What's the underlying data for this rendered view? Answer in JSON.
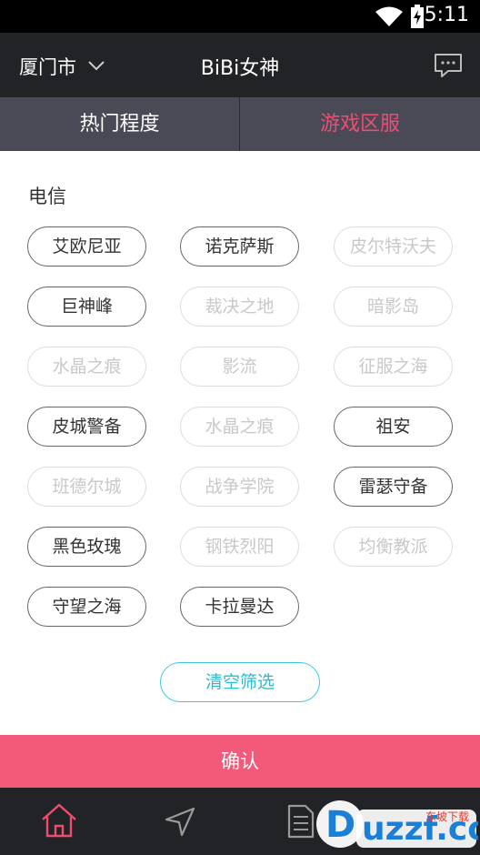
{
  "status_bar": {
    "time": "5:11"
  },
  "header": {
    "city": "厦门市",
    "title": "BiBi女神"
  },
  "tabs": [
    {
      "label": "热门程度",
      "active": false
    },
    {
      "label": "游戏区服",
      "active": true
    }
  ],
  "section": {
    "title": "电信"
  },
  "servers": [
    {
      "label": "艾欧尼亚",
      "enabled": true
    },
    {
      "label": "诺克萨斯",
      "enabled": true
    },
    {
      "label": "皮尔特沃夫",
      "enabled": false
    },
    {
      "label": "巨神峰",
      "enabled": true
    },
    {
      "label": "裁决之地",
      "enabled": false
    },
    {
      "label": "暗影岛",
      "enabled": false
    },
    {
      "label": "水晶之痕",
      "enabled": false
    },
    {
      "label": "影流",
      "enabled": false
    },
    {
      "label": "征服之海",
      "enabled": false
    },
    {
      "label": "皮城警备",
      "enabled": true
    },
    {
      "label": "水晶之痕",
      "enabled": false
    },
    {
      "label": "祖安",
      "enabled": true
    },
    {
      "label": "班德尔城",
      "enabled": false
    },
    {
      "label": "战争学院",
      "enabled": false
    },
    {
      "label": "雷瑟守备",
      "enabled": true
    },
    {
      "label": "黑色玫瑰",
      "enabled": true
    },
    {
      "label": "钢铁烈阳",
      "enabled": false
    },
    {
      "label": "均衡教派",
      "enabled": false
    },
    {
      "label": "守望之海",
      "enabled": true
    },
    {
      "label": "卡拉曼达",
      "enabled": true
    }
  ],
  "clear_button": "清空筛选",
  "confirm_button": "确认",
  "bottom_nav": [
    {
      "icon": "home-icon",
      "active": true
    },
    {
      "icon": "navigation-arrow-icon",
      "active": false
    },
    {
      "icon": "document-icon",
      "active": false
    }
  ],
  "watermark": {
    "text": "uzzf.com",
    "small_text": "东坡下载"
  },
  "colors": {
    "accent": "#ee4d71",
    "confirm": "#f35a7a",
    "clear": "#2bbbd0",
    "header": "#222327",
    "tabs": "#4a4a56"
  }
}
